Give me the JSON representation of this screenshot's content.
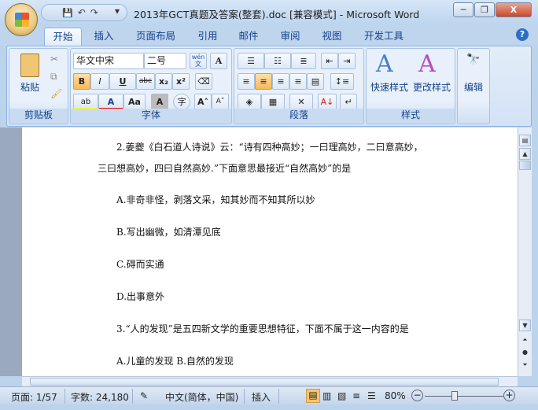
{
  "window": {
    "title": "2013年GCT真题及答案(整套).doc [兼容模式] - Microsoft Word",
    "minimize": "─",
    "restore": "❐",
    "close": "X"
  },
  "qat": {
    "save": "💾",
    "undo": "↶",
    "redo": "↷",
    "customize": "▾"
  },
  "tabs": [
    "开始",
    "插入",
    "页面布局",
    "引用",
    "邮件",
    "审阅",
    "视图",
    "开发工具"
  ],
  "help": "?",
  "ribbon": {
    "clipboard": {
      "label": "剪贴板",
      "paste": "粘贴"
    },
    "font": {
      "label": "字体",
      "font_name": "华文中宋",
      "font_size": "二号",
      "bold": "B",
      "italic": "I",
      "underline": "U",
      "strike": "abc",
      "sub": "x₂",
      "sup": "x²",
      "highlight": "ab",
      "color": "A",
      "case": "Aa",
      "shade": "A",
      "enclose": "字",
      "grow": "A˄",
      "shrink": "A˅",
      "phonetic": "wén 文",
      "border": "A"
    },
    "paragraph": {
      "label": "段落"
    },
    "styles": {
      "label": "样式",
      "quick": "快速样式",
      "change": "更改样式"
    },
    "editing": {
      "label": "编辑"
    }
  },
  "document": {
    "lines": [
      "2.姜夔《白石道人诗说》云：“诗有四种高妙；一曰理高妙，二曰意高妙，",
      "三曰想高妙，四曰自然高妙.”下面意思最接近“自然高妙”的是",
      "A.非奇非怪，剥落文采，知其妙而不知其所以妙",
      "B.写出幽微，如清潭见底",
      "C.碍而实通",
      "D.出事意外",
      "3.“人的发现”是五四新文学的重要思想特征，下面不属于这一内容的是",
      "A.儿童的发现 B.自然的发现"
    ]
  },
  "status": {
    "page": "页面: 1/57",
    "words": "字数: 24,180",
    "language": "中文(简体，中国)",
    "mode": "插入",
    "zoom": "80%",
    "zoom_percent": 80
  }
}
